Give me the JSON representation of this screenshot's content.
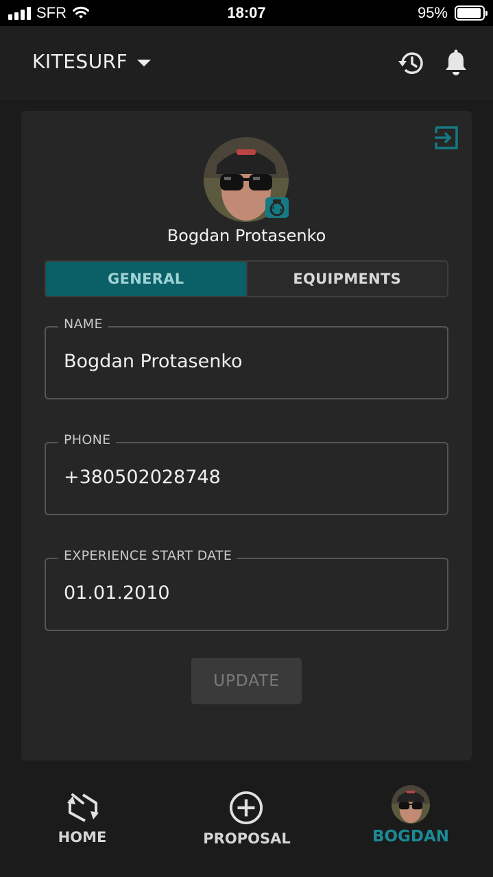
{
  "status_bar": {
    "carrier": "SFR",
    "time": "18:07",
    "battery_percent": "95%",
    "battery_level": 0.95
  },
  "header": {
    "title": "KITESURF",
    "icons": [
      "history-icon",
      "bell-icon"
    ]
  },
  "profile": {
    "user_name": "Bogdan Protasenko",
    "tabs": [
      {
        "label": "GENERAL",
        "active": true
      },
      {
        "label": "EQUIPMENTS",
        "active": false
      }
    ],
    "fields": {
      "name": {
        "label": "NAME",
        "value": "Bogdan Protasenko"
      },
      "phone": {
        "label": "PHONE",
        "value": "+380502028748"
      },
      "experience": {
        "label": "EXPERIENCE START DATE",
        "value": "01.01.2010"
      }
    },
    "update_label": "UPDATE"
  },
  "bottom_nav": {
    "home": "HOME",
    "proposal": "PROPOSAL",
    "profile": "BOGDAN"
  },
  "colors": {
    "accent": "#157a83",
    "tab_active_bg": "#0b5f66",
    "background": "#1b1b1b",
    "card": "#262626"
  }
}
